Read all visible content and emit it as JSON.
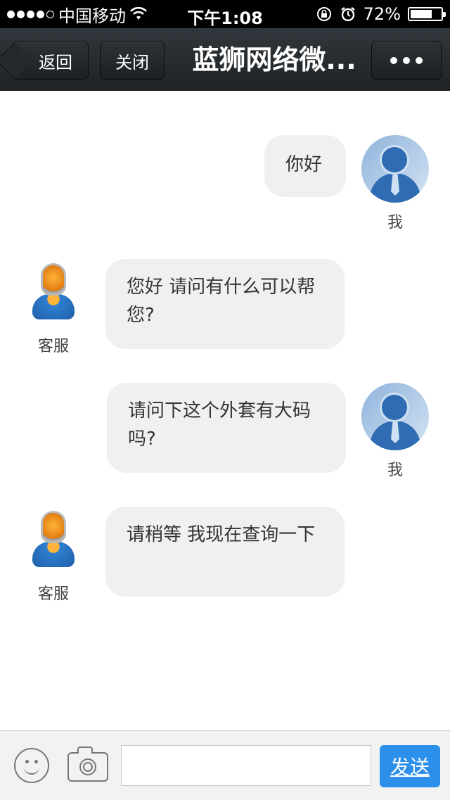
{
  "status_bar": {
    "carrier": "中国移动",
    "time": "下午1:08",
    "battery": "72%",
    "battery_level": 0.72,
    "icons": [
      "signal-dots-icon",
      "wifi-icon",
      "orientation-lock-icon",
      "alarm-icon",
      "battery-icon"
    ]
  },
  "navbar": {
    "back_label": "返回",
    "close_label": "关闭",
    "title": "蓝狮网络微...",
    "more_icon": "more-dots-icon"
  },
  "messages": [
    {
      "sender": "me",
      "name": "我",
      "text": "你好"
    },
    {
      "sender": "service",
      "name": "客服",
      "text": "您好  请问有什么可以帮您?"
    },
    {
      "sender": "me",
      "name": "我",
      "text": "请问下这个外套有大码吗?"
    },
    {
      "sender": "service",
      "name": "客服",
      "text": "请稍等 我现在查询一下"
    }
  ],
  "toolbar": {
    "emoji_icon": "smiley-icon",
    "camera_icon": "camera-icon",
    "input_value": "",
    "send_label": "发送"
  },
  "colors": {
    "nav_bg": "#252a2e",
    "bubble_bg": "#f0f0f0",
    "send_bg": "#2c8fea"
  }
}
